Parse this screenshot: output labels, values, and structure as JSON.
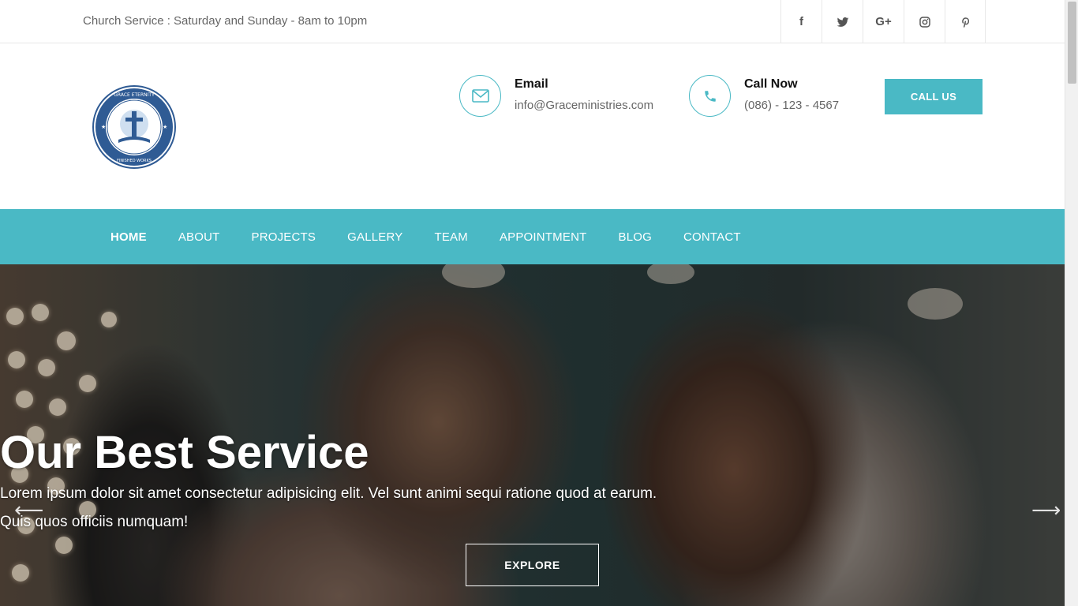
{
  "topbar": {
    "service_text": "Church Service : Saturday and Sunday - 8am to 10pm",
    "social": [
      {
        "icon": "facebook-icon",
        "glyph": "f"
      },
      {
        "icon": "twitter-icon",
        "glyph": ""
      },
      {
        "icon": "google-plus-icon",
        "glyph": "G+"
      },
      {
        "icon": "instagram-icon",
        "glyph": ""
      },
      {
        "icon": "pinterest-icon",
        "glyph": ""
      }
    ]
  },
  "header": {
    "logo_text_top": "GRACE ETERNITY MINISTRIES",
    "logo_text_bottom": "VICTORY IN JESUS' FINISHED WORKS",
    "email_label": "Email",
    "email_value": "info@Graceministries.com",
    "call_label": "Call Now",
    "call_value": "(086) - 123 - 4567",
    "call_button": "CALL US"
  },
  "nav": {
    "items": [
      "HOME",
      "ABOUT",
      "PROJECTS",
      "GALLERY",
      "TEAM",
      "APPOINTMENT",
      "BLOG",
      "CONTACT"
    ],
    "active": "HOME"
  },
  "hero": {
    "title": "Our Best Service",
    "text_line1": "Lorem ipsum dolor sit amet consectetur adipisicing elit. Vel sunt animi sequi ratione quod at earum.",
    "text_line2": "Quis quos officiis numquam!",
    "button": "EXPLORE",
    "prev_arrow": "⟵",
    "next_arrow": "⟶"
  },
  "colors": {
    "accent": "#4ab9c5",
    "text_dark": "#111111",
    "text_muted": "#666666"
  }
}
